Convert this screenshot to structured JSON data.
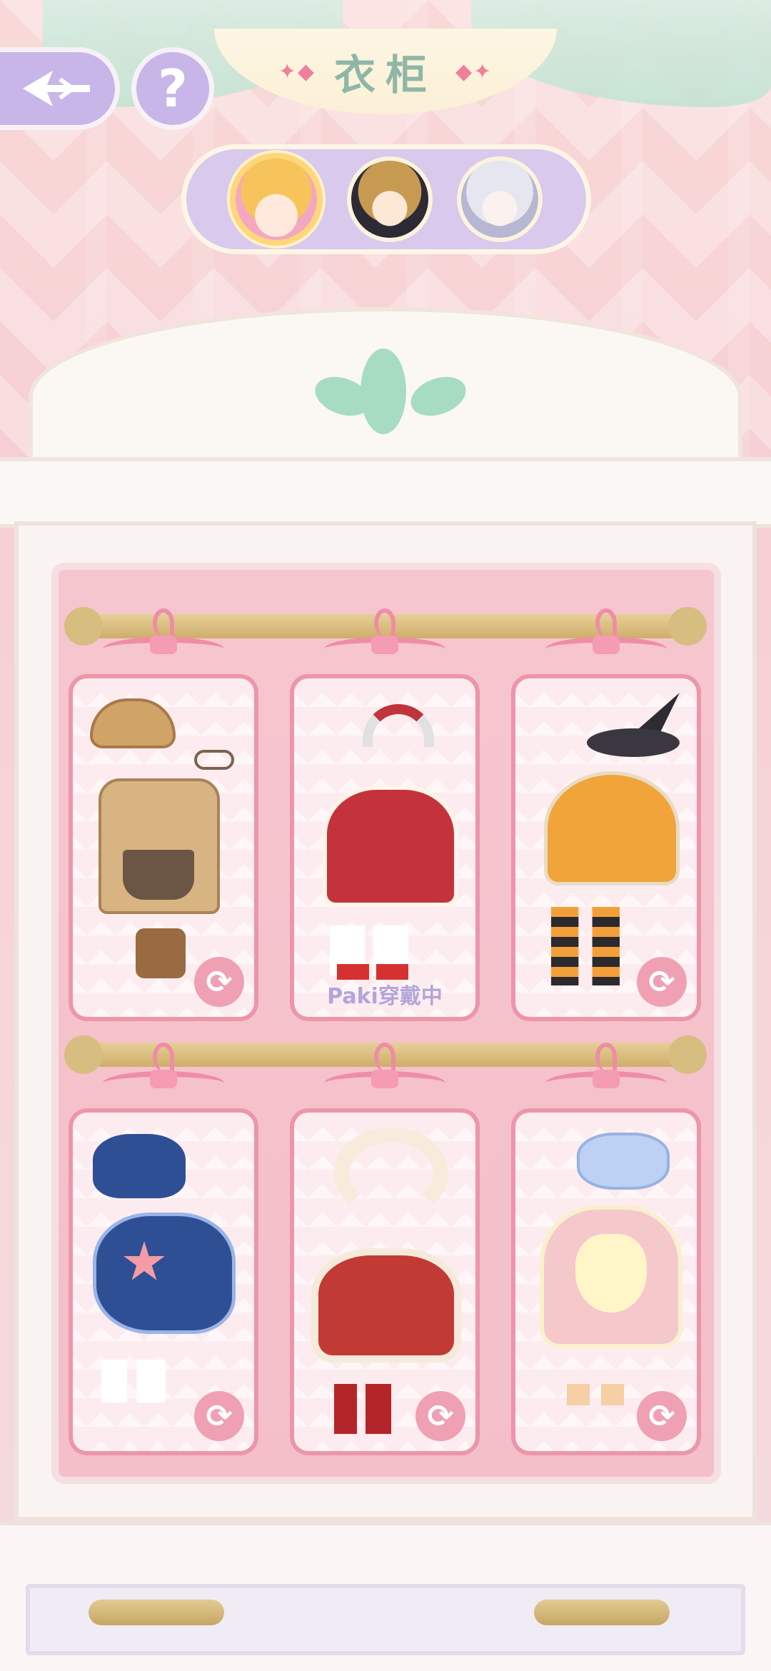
{
  "header": {
    "title": "衣柜",
    "back_icon": "back-arrow-icon",
    "help_label": "?"
  },
  "characters": [
    {
      "name": "character-1",
      "selected": true
    },
    {
      "name": "character-2",
      "selected": false
    },
    {
      "name": "character-3",
      "selected": false
    }
  ],
  "wardrobe": {
    "outfits": [
      {
        "id": 1,
        "theme": "detective"
      },
      {
        "id": 2,
        "theme": "christmas",
        "status": "Paki穿戴中"
      },
      {
        "id": 3,
        "theme": "witch"
      },
      {
        "id": 4,
        "theme": "sailor"
      },
      {
        "id": 5,
        "theme": "rabbit"
      },
      {
        "id": 6,
        "theme": "maid"
      }
    ],
    "swap_icon": "refresh-icon"
  },
  "colors": {
    "accent": "#c8b6e8",
    "card_border": "#ec95ab",
    "status_text": "#b3a5da"
  }
}
